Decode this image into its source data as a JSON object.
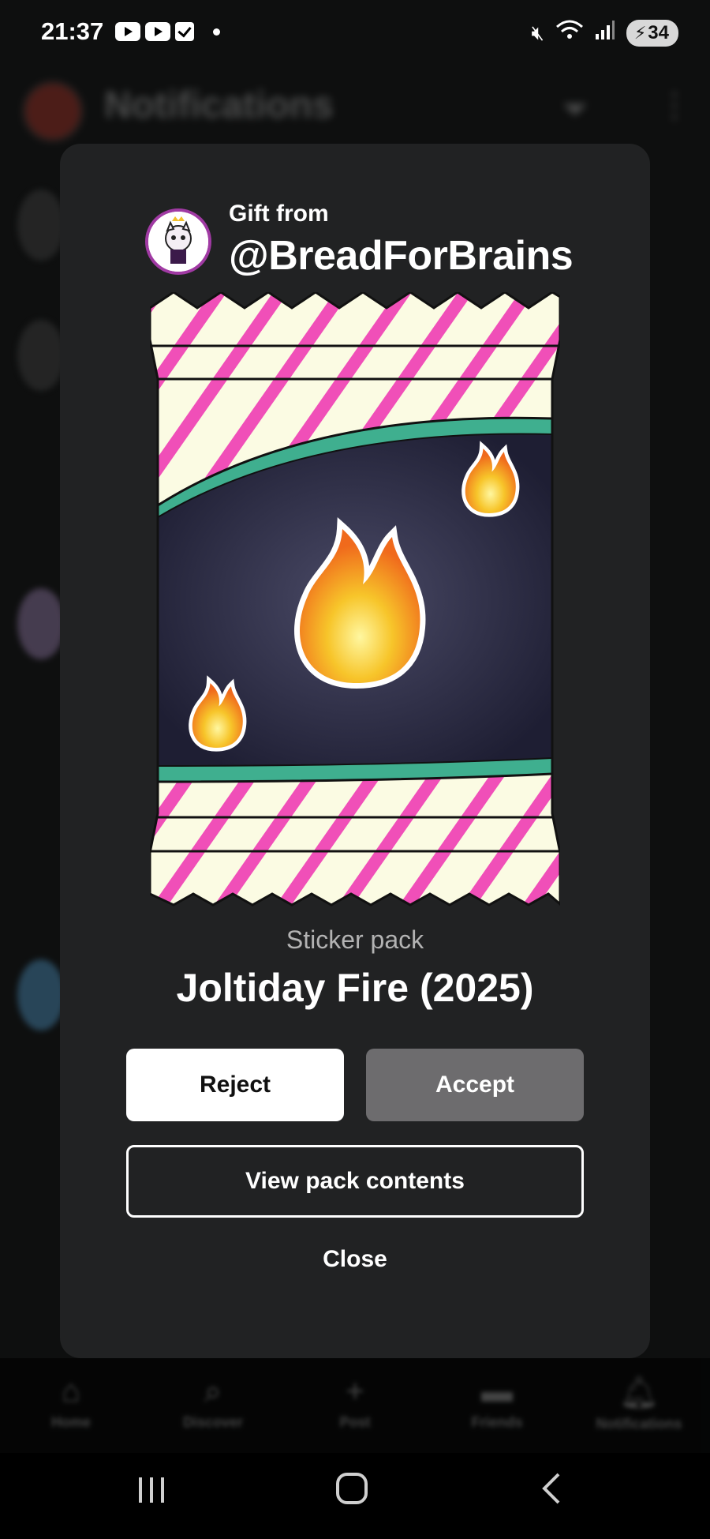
{
  "status_bar": {
    "time": "21:37",
    "battery": "34",
    "icons": [
      "youtube-icon",
      "youtube-icon",
      "checkbox-icon",
      "dot-icon",
      "mute-icon",
      "wifi-icon",
      "signal-icon",
      "battery-icon"
    ]
  },
  "background": {
    "title": "Notifications",
    "nav": [
      "Home",
      "Discover",
      "Post",
      "Friends",
      "Notifications"
    ]
  },
  "modal": {
    "gift_from": "Gift from",
    "sender": "@BreadForBrains",
    "pack_type": "Sticker pack",
    "pack_name": "Joltiday Fire (2025)",
    "reject_label": "Reject",
    "accept_label": "Accept",
    "view_label": "View pack contents",
    "close_label": "Close"
  },
  "colors": {
    "modal_bg": "#212223",
    "accept_bg": "#6d6c6e",
    "stripe_pink": "#f04fb8",
    "pack_cream": "#fbfbe3",
    "teal": "#3faf8f"
  }
}
